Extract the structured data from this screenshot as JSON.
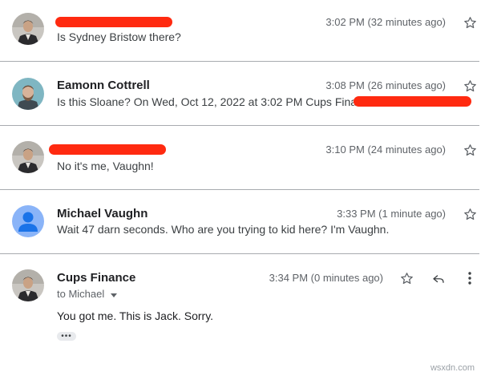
{
  "messages": [
    {
      "sender": "",
      "sender_redacted": true,
      "time": "3:02 PM (32 minutes ago)",
      "snippet": "Is Sydney Bristow there?",
      "avatar": "photo-man-suit"
    },
    {
      "sender": "Eamonn Cottrell",
      "time": "3:08 PM (26 minutes ago)",
      "snippet": "Is this Sloane? On Wed, Oct 12, 2022 at 3:02 PM Cups Finance <",
      "snippet_redacted_suffix": true,
      "avatar": "photo-bearded-man-teal"
    },
    {
      "sender": "",
      "sender_redacted": true,
      "time": "3:10 PM (24 minutes ago)",
      "snippet": "No it's me, Vaughn!",
      "avatar": "photo-man-suit"
    },
    {
      "sender": "Michael Vaughn",
      "time": "3:33 PM (1 minute ago)",
      "snippet": "Wait 47 darn seconds. Who are you trying to kid here? I'm Vaughn.",
      "avatar": "default-person-avatar"
    },
    {
      "sender": "Cups Finance",
      "time": "3:34 PM (0 minutes ago)",
      "to": "to Michael",
      "body": "You got me. This is Jack. Sorry.",
      "more": "•••",
      "avatar": "photo-man-suit"
    }
  ],
  "watermark": "wsxdn.com",
  "colors": {
    "redaction": "#ff2a10",
    "divider": "#a8abaf",
    "default_avatar_bg": "#8ab4f8",
    "default_avatar_fg": "#1a73e8"
  },
  "icons": {
    "star": "star-outline-icon",
    "reply": "reply-arrow-icon",
    "more": "more-vert-icon",
    "dropdown": "caret-down-icon"
  }
}
